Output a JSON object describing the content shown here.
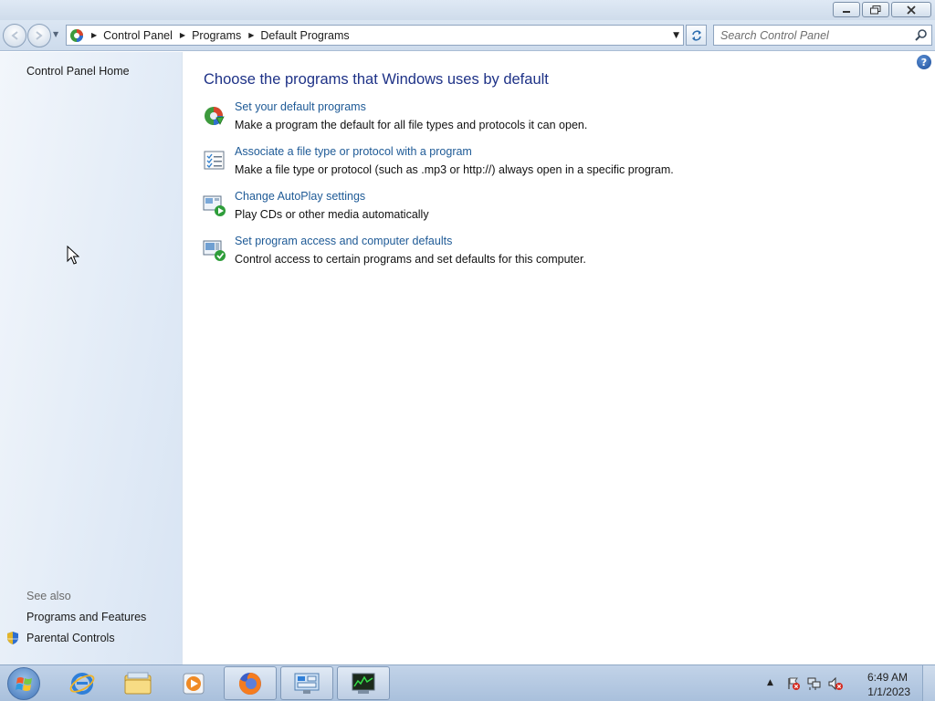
{
  "window": {
    "controls": [
      "minimize",
      "restore",
      "close"
    ]
  },
  "navbar": {
    "breadcrumbs": [
      "Control Panel",
      "Programs",
      "Default Programs"
    ],
    "search_placeholder": "Search Control Panel"
  },
  "sidebar": {
    "home": "Control Panel Home",
    "see_also": "See also",
    "links": [
      "Programs and Features",
      "Parental Controls"
    ]
  },
  "main": {
    "title": "Choose the programs that Windows uses by default",
    "tasks": [
      {
        "link": "Set your default programs",
        "desc": "Make a program the default for all file types and protocols it can open.",
        "icon": "default-programs-icon"
      },
      {
        "link": "Associate a file type or protocol with a program",
        "desc": "Make a file type or protocol (such as .mp3 or http://) always open in a specific program.",
        "icon": "file-association-icon"
      },
      {
        "link": "Change AutoPlay settings",
        "desc": "Play CDs or other media automatically",
        "icon": "autoplay-icon"
      },
      {
        "link": "Set program access and computer defaults",
        "desc": "Control access to certain programs and set defaults for this computer.",
        "icon": "program-access-icon"
      }
    ]
  },
  "taskbar": {
    "items": [
      "internet-explorer-icon",
      "file-explorer-icon",
      "media-player-icon",
      "firefox-icon",
      "control-panel-icon",
      "task-manager-icon"
    ],
    "clock_time": "6:49 AM",
    "clock_date": "1/1/2023"
  },
  "colors": {
    "link": "#1e5a96",
    "title": "#1e3287",
    "taskbar": "#b4c8e1"
  }
}
